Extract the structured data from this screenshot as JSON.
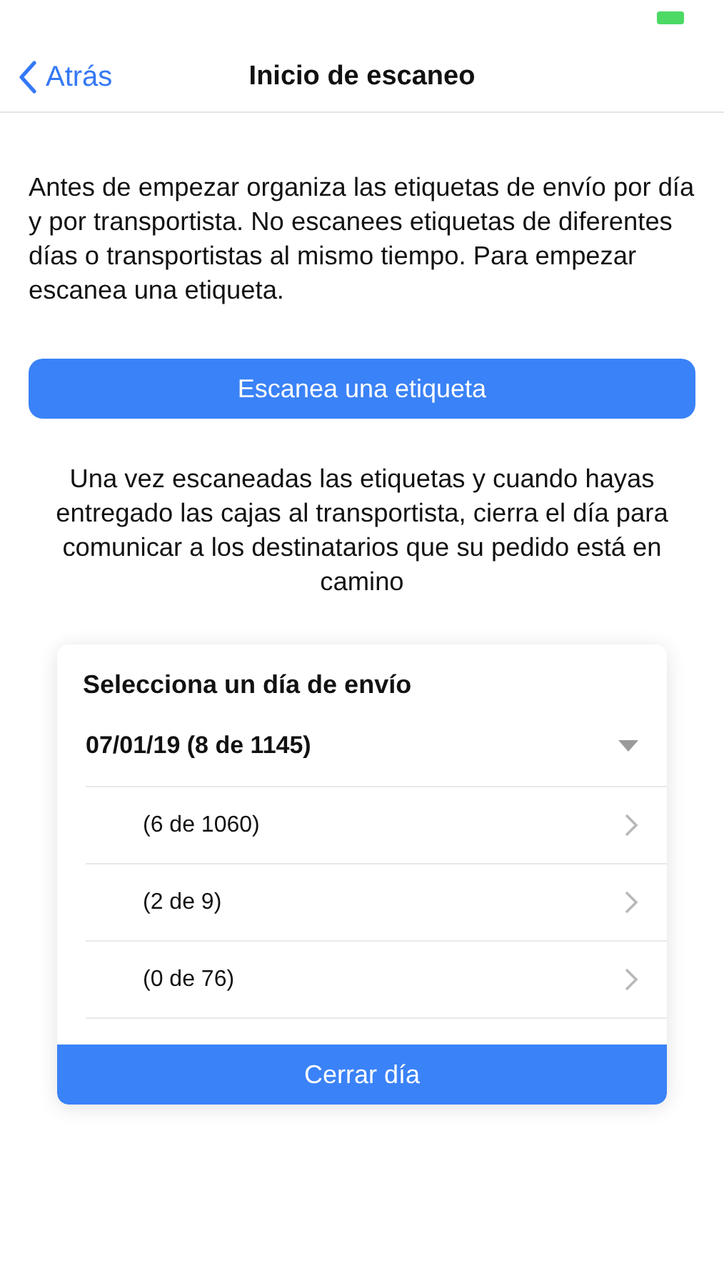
{
  "nav": {
    "back": "Atrás",
    "title": "Inicio de escaneo"
  },
  "intro": "Antes de empezar organiza las etiquetas de envío por día y por transportista. No escanees etiquetas de diferentes días o transportistas al mismo tiempo. Para empezar escanea una etiqueta.",
  "scan_button": "Escanea una etiqueta",
  "note": "Una vez escaneadas las etiquetas y cuando hayas entregado las cajas al transportista, cierra el día para comunicar a los destinatarios que su pedido está en camino",
  "card": {
    "title": "Selecciona un día de envío",
    "day": {
      "label": "07/01/19 (8 de 1145)",
      "expanded": true
    },
    "carriers": [
      {
        "count": "(6 de 1060)"
      },
      {
        "count": "(2 de 9)"
      },
      {
        "count": "(0 de 76)"
      }
    ],
    "close_button": "Cerrar día"
  }
}
